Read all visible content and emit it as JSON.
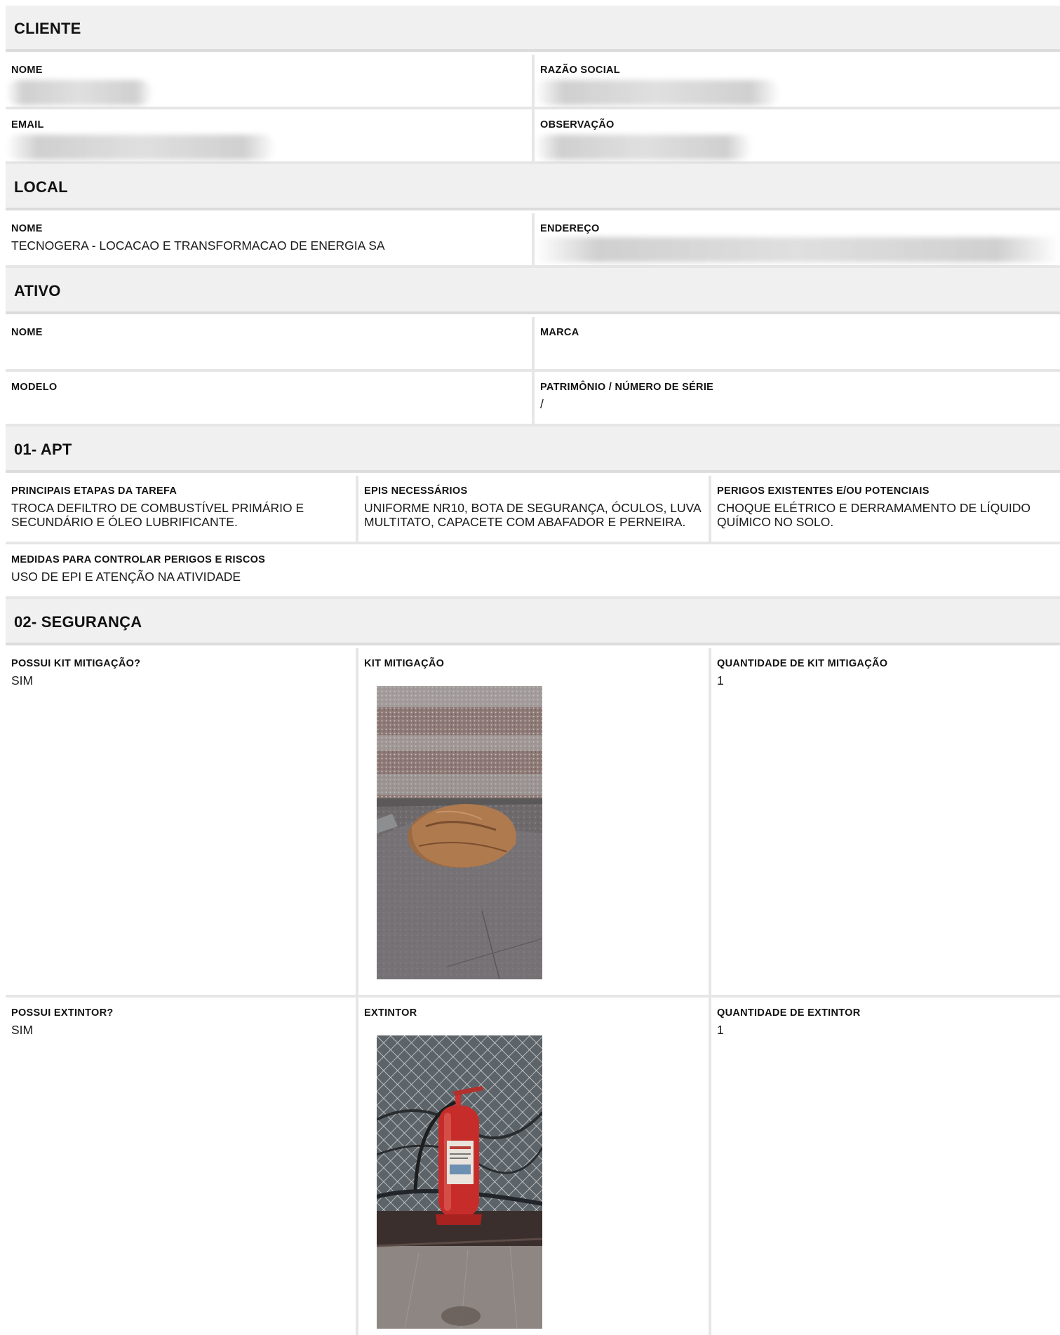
{
  "cliente": {
    "title": "CLIENTE",
    "nome_label": "NOME",
    "razao_label": "RAZÃO SOCIAL",
    "email_label": "EMAIL",
    "obs_label": "OBSERVAÇÃO"
  },
  "local": {
    "title": "LOCAL",
    "nome_label": "NOME",
    "nome_value": "TECNOGERA - LOCACAO E TRANSFORMACAO DE ENERGIA SA",
    "endereco_label": "ENDEREÇO"
  },
  "ativo": {
    "title": "ATIVO",
    "nome_label": "NOME",
    "marca_label": "MARCA",
    "modelo_label": "MODELO",
    "patrimonio_label": "PATRIMÔNIO / NÚMERO DE SÉRIE",
    "patrimonio_value": "/"
  },
  "apt": {
    "title": "01- APT",
    "etapas_label": "PRINCIPAIS ETAPAS DA TAREFA",
    "etapas_value": "TROCA DEFILTRO DE COMBUSTÍVEL PRIMÁRIO E SECUNDÁRIO E ÓLEO LUBRIFICANTE.",
    "epis_label": "EPIS NECESSÁRIOS",
    "epis_value": "UNIFORME NR10, BOTA DE SEGURANÇA, ÓCULOS, LUVA MULTITATO, CAPACETE COM ABAFADOR E PERNEIRA.",
    "perigos_label": "PERIGOS EXISTENTES E/OU POTENCIAIS",
    "perigos_value": "CHOQUE ELÉTRICO E DERRAMAMENTO DE LÍQUIDO QUÍMICO NO SOLO.",
    "medidas_label": "MEDIDAS PARA CONTROLAR PERIGOS E RISCOS",
    "medidas_value": "USO DE EPI E ATENÇÃO NA ATIVIDADE"
  },
  "seguranca": {
    "title": "02- SEGURANÇA",
    "possui_kit_label": "POSSUI KIT MITIGAÇÃO?",
    "possui_kit_value": "SIM",
    "kit_label": "KIT MITIGAÇÃO",
    "qtd_kit_label": "QUANTIDADE DE KIT MITIGAÇÃO",
    "qtd_kit_value": "1",
    "possui_extintor_label": "POSSUI EXTINTOR?",
    "possui_extintor_value": "SIM",
    "extintor_label": "EXTINTOR",
    "qtd_extintor_label": "QUANTIDADE DE EXTINTOR",
    "qtd_extintor_value": "1"
  }
}
